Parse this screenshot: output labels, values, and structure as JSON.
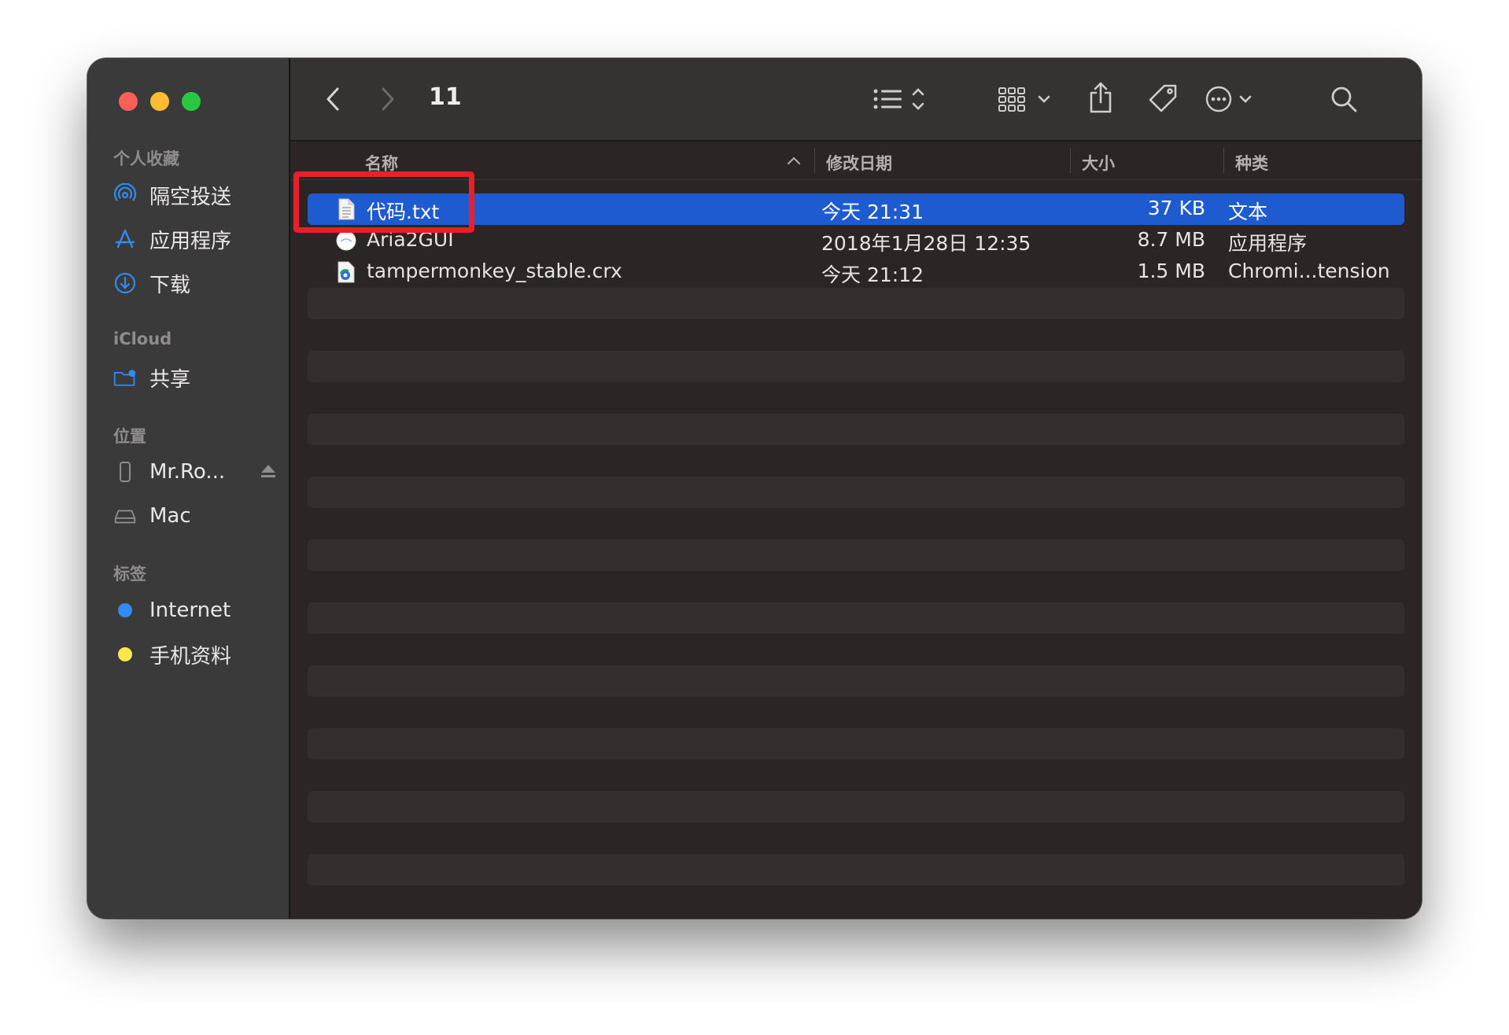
{
  "toolbar": {
    "title": "11"
  },
  "sidebar": {
    "favorites_header": "个人收藏",
    "favorites": [
      {
        "label": "隔空投送",
        "icon": "airdrop-icon"
      },
      {
        "label": "应用程序",
        "icon": "applications-icon"
      },
      {
        "label": "下载",
        "icon": "downloads-icon"
      }
    ],
    "icloud_header": "iCloud",
    "icloud": [
      {
        "label": "共享",
        "icon": "shared-folder-icon"
      }
    ],
    "locations_header": "位置",
    "locations": [
      {
        "label": "Mr.Ro...",
        "icon": "phone-icon"
      },
      {
        "label": "Mac",
        "icon": "disk-icon"
      }
    ],
    "tags_header": "标签",
    "tags": [
      {
        "label": "Internet",
        "color": "#2f8cf3"
      },
      {
        "label": "手机资料",
        "color": "#fde74c"
      }
    ]
  },
  "columns": {
    "name": "名称",
    "date": "修改日期",
    "size": "大小",
    "kind": "种类"
  },
  "files": [
    {
      "name": "代码.txt",
      "date": "今天 21:31",
      "size": "37 KB",
      "kind": "文本",
      "icon": "text-file-icon",
      "selected": true
    },
    {
      "name": "Aria2GUI",
      "date": "2018年1月28日 12:35",
      "size": "8.7 MB",
      "kind": "应用程序",
      "icon": "app-icon"
    },
    {
      "name": "tampermonkey_stable.crx",
      "date": "今天 21:12",
      "size": "1.5 MB",
      "kind": "Chromi...tension",
      "icon": "chrome-extension-icon"
    }
  ],
  "colors": {
    "selection": "#1f5bd0",
    "annotation": "#e8202b"
  }
}
